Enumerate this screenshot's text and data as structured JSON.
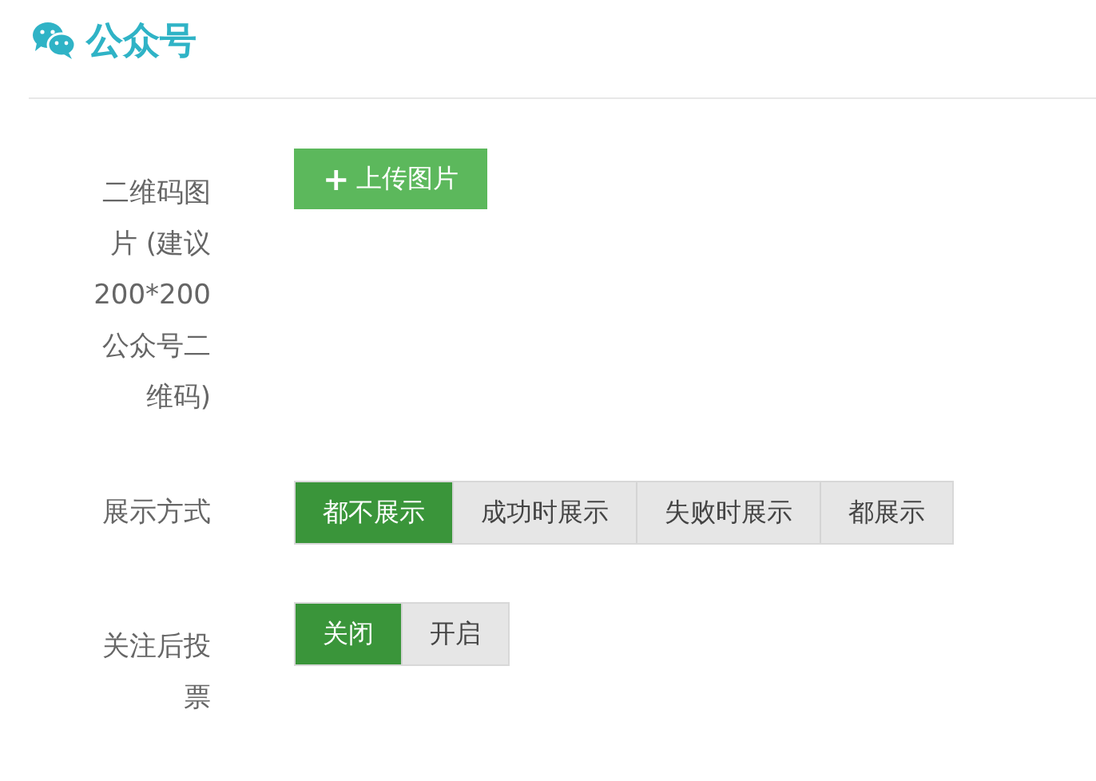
{
  "title": "公众号",
  "fields": [
    {
      "kind": "upload",
      "label": "二维码图片 (建议200*200公众号二维码)",
      "button": {
        "icon": "+",
        "label": "上传图片"
      }
    },
    {
      "kind": "segmented",
      "label": "展示方式",
      "options": [
        {
          "label": "都不展示",
          "selected": true
        },
        {
          "label": "成功时展示",
          "selected": false
        },
        {
          "label": "失败时展示",
          "selected": false
        },
        {
          "label": "都展示",
          "selected": false
        }
      ]
    },
    {
      "kind": "segmented",
      "label": "关注后投票",
      "options": [
        {
          "label": "关闭",
          "selected": true
        },
        {
          "label": "开启",
          "selected": false
        }
      ]
    }
  ]
}
